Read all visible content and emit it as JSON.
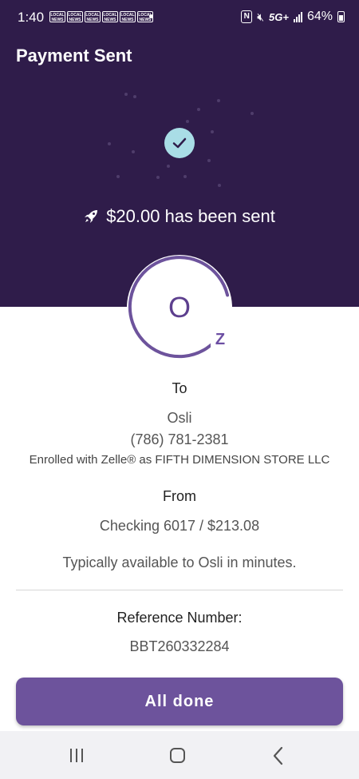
{
  "status_bar": {
    "time": "1:40",
    "news_icon_text": "LOCAL NEWS",
    "network": "5G+",
    "battery": "64%"
  },
  "header": {
    "title": "Payment Sent",
    "sent_message": "$20.00 has been sent"
  },
  "recipient": {
    "initial": "O",
    "to_label": "To",
    "name": "Osli",
    "phone": "(786) 781-2381",
    "enrolled": "Enrolled with Zelle® as FIFTH DIMENSION STORE LLC"
  },
  "sender": {
    "from_label": "From",
    "account": "Checking 6017 / $213.08"
  },
  "availability_note": "Typically available to Osli in minutes.",
  "reference": {
    "label": "Reference Number:",
    "number": "BBT260332284"
  },
  "actions": {
    "done_label": "All done"
  },
  "colors": {
    "header_bg": "#2f1c4a",
    "accent": "#6d539c",
    "check_bg": "#a9dde6"
  }
}
